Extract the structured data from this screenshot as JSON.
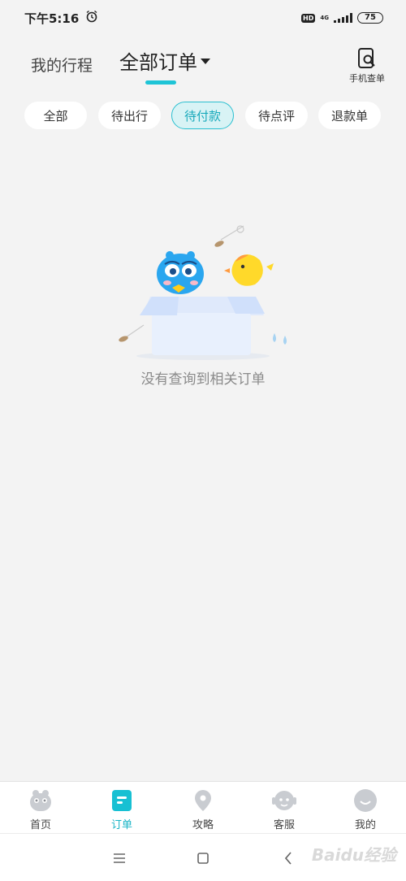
{
  "status_bar": {
    "time": "下午5:16",
    "hd": "HD",
    "network": "4G",
    "battery": "75",
    "alarm_icon": "alarm-icon"
  },
  "header": {
    "tab_trip": "我的行程",
    "tab_all_orders": "全部订单",
    "phone_lookup_label": "手机查单",
    "accent_color": "#1ec4d6"
  },
  "filters": [
    {
      "label": "全部",
      "active": false
    },
    {
      "label": "待出行",
      "active": false
    },
    {
      "label": "待付款",
      "active": true
    },
    {
      "label": "待点评",
      "active": false
    },
    {
      "label": "退款单",
      "active": false
    }
  ],
  "empty_state": {
    "message": "没有查询到相关订单"
  },
  "bottom_nav": [
    {
      "label": "首页",
      "icon": "home-mascot-icon",
      "active": false
    },
    {
      "label": "订单",
      "icon": "order-icon",
      "active": true
    },
    {
      "label": "攻略",
      "icon": "location-pin-icon",
      "active": false
    },
    {
      "label": "客服",
      "icon": "customer-service-icon",
      "active": false
    },
    {
      "label": "我的",
      "icon": "profile-icon",
      "active": false
    }
  ],
  "system_bar": {
    "watermark": "Baidu经验"
  }
}
